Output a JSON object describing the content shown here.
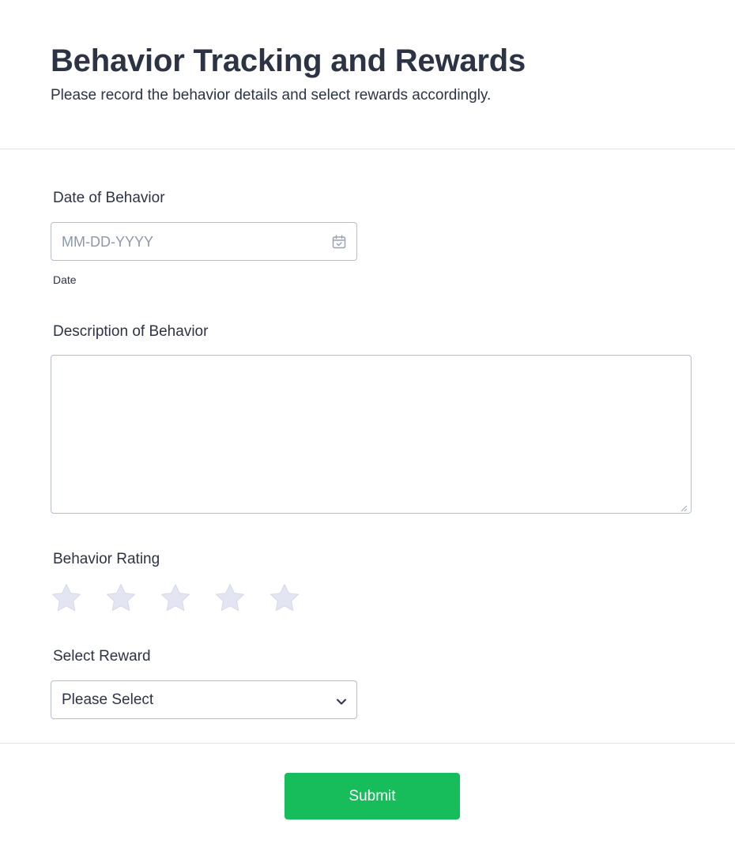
{
  "header": {
    "title": "Behavior Tracking and Rewards",
    "subtitle": "Please record the behavior details and select rewards accordingly."
  },
  "date_field": {
    "label": "Date of Behavior",
    "placeholder": "MM-DD-YYYY",
    "sublabel": "Date",
    "icon": "calendar-icon",
    "value": ""
  },
  "description_field": {
    "label": "Description of Behavior",
    "value": ""
  },
  "rating_field": {
    "label": "Behavior Rating",
    "max_stars": 5,
    "value": 0,
    "icon": "star-icon",
    "star_color": "#e3e5f2"
  },
  "reward_field": {
    "label": "Select Reward",
    "selected": "Please Select",
    "icon": "chevron-down-icon"
  },
  "submit": {
    "label": "Submit",
    "color": "#18bd5b"
  }
}
